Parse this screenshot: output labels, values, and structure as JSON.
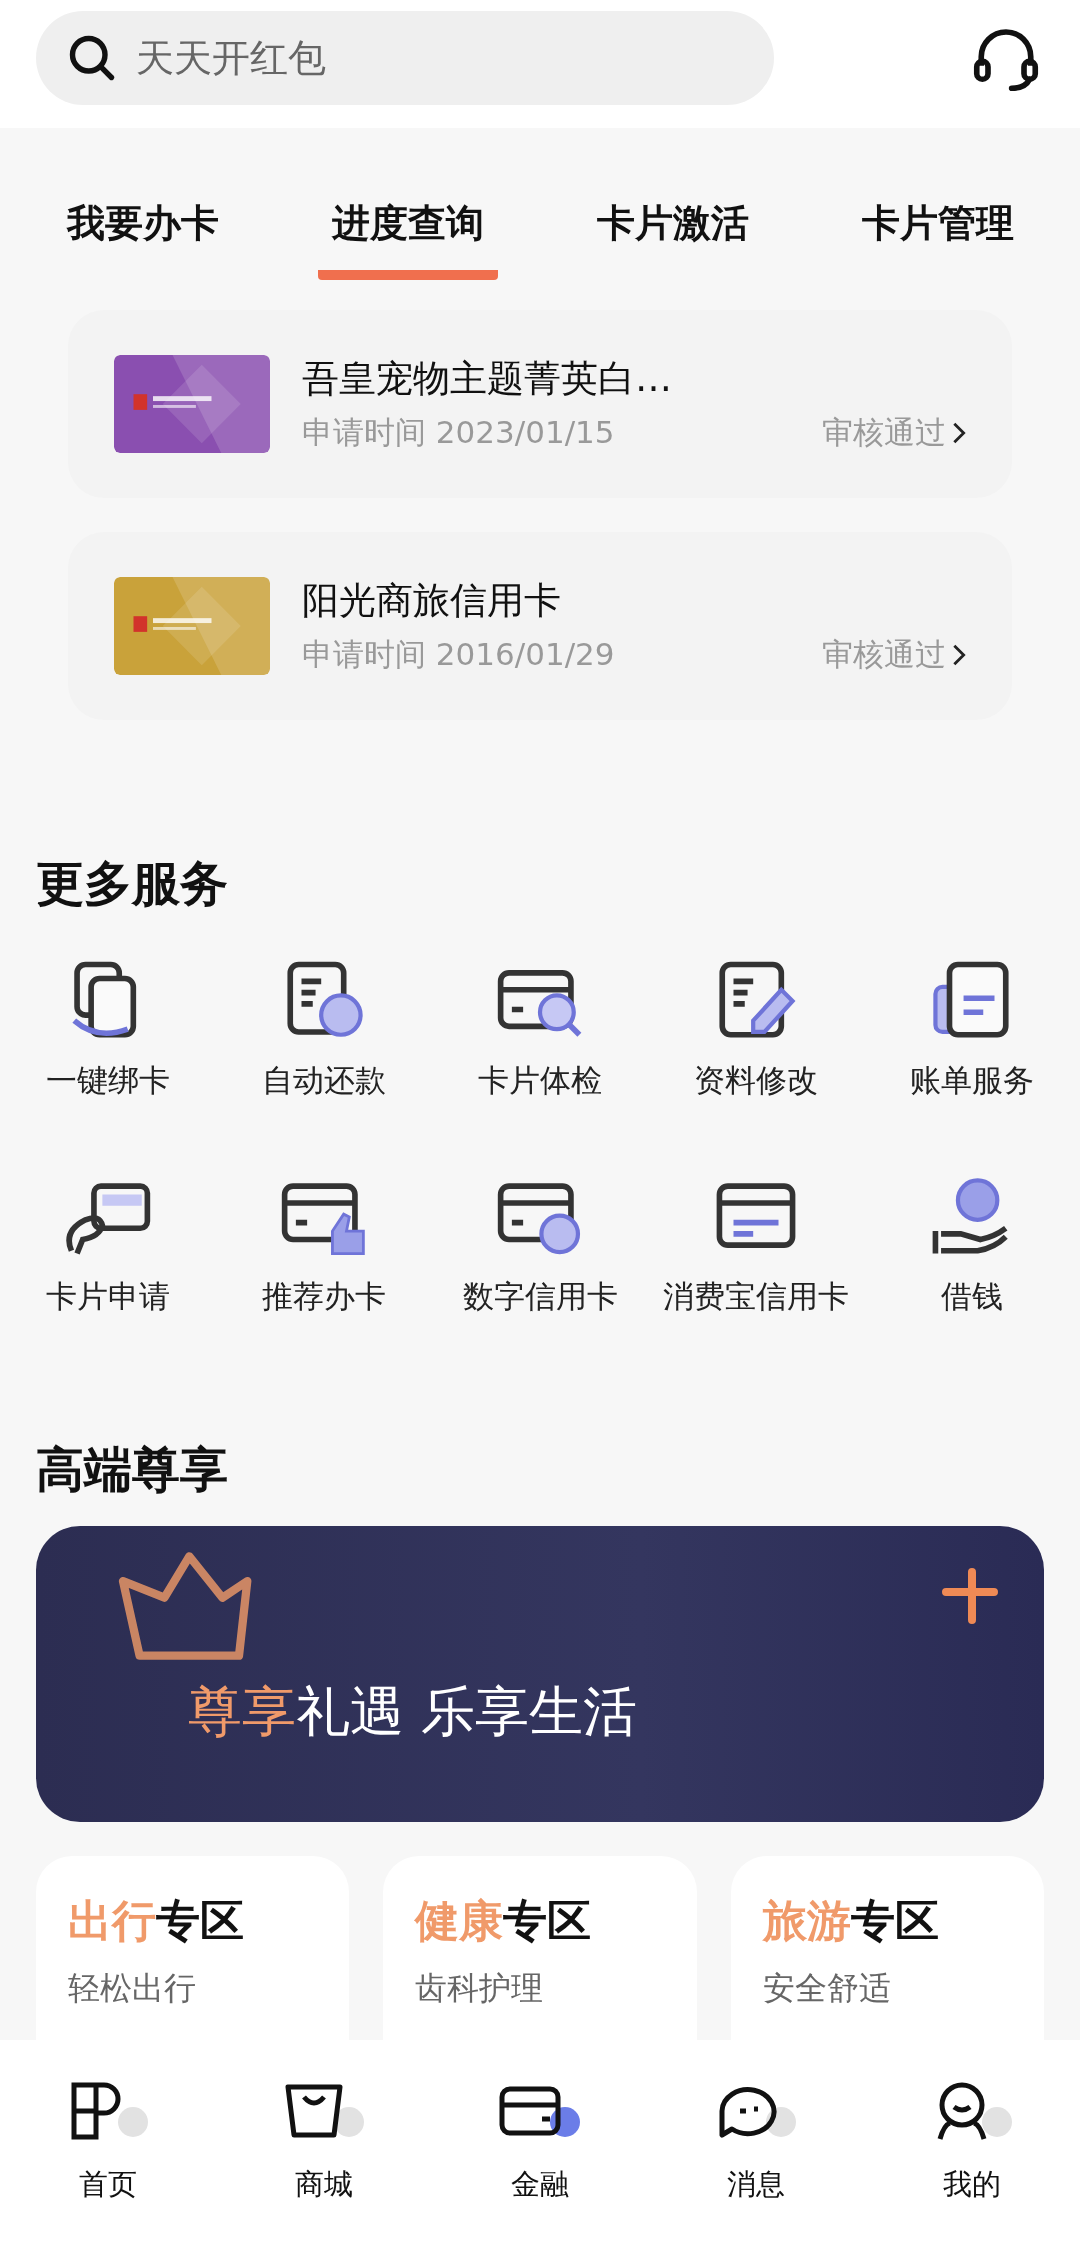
{
  "search": {
    "placeholder": "天天开红包"
  },
  "tabs": [
    {
      "label": "我要办卡",
      "selected": false
    },
    {
      "label": "进度查询",
      "selected": true
    },
    {
      "label": "卡片激活",
      "selected": false
    },
    {
      "label": "卡片管理",
      "selected": false
    }
  ],
  "applications": [
    {
      "kind": "picture",
      "card_name": "吾皇宠物主题菁英白…",
      "apply_label": "申请时间",
      "apply_date": "2023/01/15",
      "status": "审核通过",
      "color": "#8a4fb0"
    },
    {
      "kind": "picture",
      "card_name": "阳光商旅信用卡",
      "apply_label": "申请时间",
      "apply_date": "2016/01/29",
      "status": "审核通过",
      "color": "#c9a23a"
    }
  ],
  "more_services": {
    "title": "更多服务",
    "items": [
      {
        "label": "一键绑卡"
      },
      {
        "label": "自动还款"
      },
      {
        "label": "卡片体检"
      },
      {
        "label": "资料修改"
      },
      {
        "label": "账单服务"
      },
      {
        "label": "卡片申请"
      },
      {
        "label": "推荐办卡"
      },
      {
        "label": "数字信用卡"
      },
      {
        "label": "消费宝信用卡"
      },
      {
        "label": "借钱"
      }
    ]
  },
  "premium": {
    "title": "高端尊享",
    "banner": {
      "accent": "尊享",
      "text": "礼遇 乐享生活"
    },
    "zones": [
      {
        "accent": "出行",
        "title": "专区",
        "subtitle": "轻松出行"
      },
      {
        "accent": "健康",
        "title": "专区",
        "subtitle": "齿科护理"
      },
      {
        "accent": "旅游",
        "title": "专区",
        "subtitle": "安全舒适"
      }
    ]
  },
  "bottom_nav": [
    {
      "label": "首页",
      "selected": false
    },
    {
      "label": "商城",
      "selected": false
    },
    {
      "label": "金融",
      "selected": true
    },
    {
      "label": "消息",
      "selected": false
    },
    {
      "label": "我的",
      "selected": false
    }
  ]
}
